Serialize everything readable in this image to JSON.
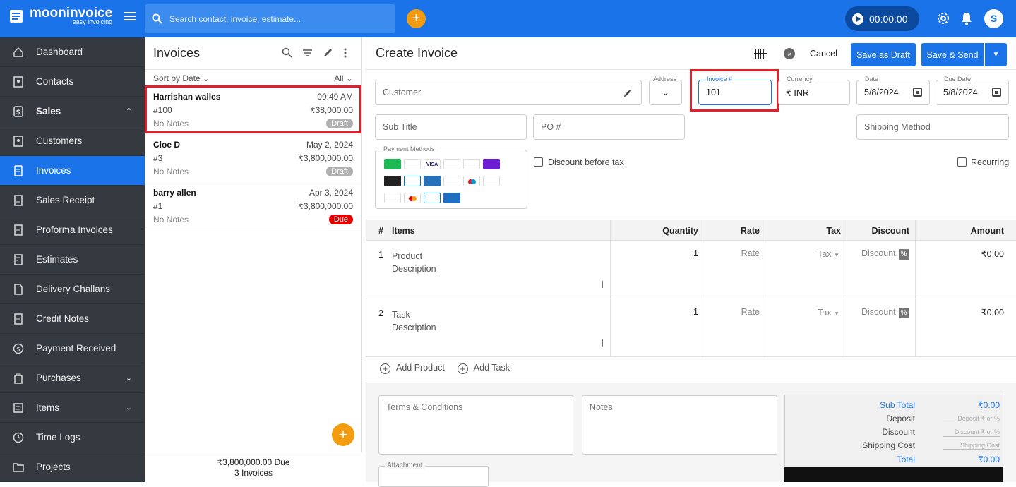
{
  "brand": {
    "name": "mooninvoice",
    "tagline": "easy invoicing"
  },
  "search": {
    "placeholder": "Search contact, invoice, estimate..."
  },
  "timer": {
    "value": "00:00:00"
  },
  "user": {
    "initial": "S"
  },
  "sidebar": {
    "items": [
      {
        "label": "Dashboard",
        "icon": "home-icon"
      },
      {
        "label": "Contacts",
        "icon": "contacts-icon"
      },
      {
        "label": "Sales",
        "icon": "dollar-icon",
        "expanded": true
      },
      {
        "label": "Customers",
        "icon": "customers-icon"
      },
      {
        "label": "Invoices",
        "icon": "invoice-icon",
        "active": true
      },
      {
        "label": "Sales Receipt",
        "icon": "receipt-icon"
      },
      {
        "label": "Proforma Invoices",
        "icon": "proforma-icon"
      },
      {
        "label": "Estimates",
        "icon": "estimate-icon"
      },
      {
        "label": "Delivery Challans",
        "icon": "delivery-icon"
      },
      {
        "label": "Credit Notes",
        "icon": "credit-note-icon"
      },
      {
        "label": "Payment Received",
        "icon": "payment-icon"
      },
      {
        "label": "Purchases",
        "icon": "purchase-icon"
      },
      {
        "label": "Items",
        "icon": "items-icon"
      },
      {
        "label": "Time Logs",
        "icon": "clock-icon"
      },
      {
        "label": "Projects",
        "icon": "folder-icon"
      }
    ]
  },
  "list": {
    "title": "Invoices",
    "sort_label": "Sort by Date",
    "filter_label": "All",
    "invoices": [
      {
        "name": "Harrishan walles",
        "date": "09:49 AM",
        "number": "#100",
        "amount": "₹38,000.00",
        "notes": "No Notes",
        "status": "Draft"
      },
      {
        "name": "Cloe D",
        "date": "May 2, 2024",
        "number": "#3",
        "amount": "₹3,800,000.00",
        "notes": "No Notes",
        "status": "Draft"
      },
      {
        "name": "barry allen",
        "date": "Apr 3, 2024",
        "number": "#1",
        "amount": "₹3,800,000.00",
        "notes": "No Notes",
        "status": "Due"
      }
    ],
    "footer_due": "₹3,800,000.00  Due",
    "footer_count": "3 Invoices"
  },
  "main": {
    "title": "Create Invoice",
    "cancel": "Cancel",
    "save_draft": "Save as Draft",
    "save_send": "Save & Send",
    "customer_placeholder": "Customer",
    "address_label": "Address",
    "invoice_label": "Invoice #",
    "invoice_value": "101",
    "currency_label": "Currency",
    "currency_value": "₹ INR",
    "date_label": "Date",
    "date_value": "5/8/2024",
    "due_label": "Due Date",
    "due_value": "5/8/2024",
    "subtitle_placeholder": "Sub Title",
    "po_placeholder": "PO #",
    "shipping_placeholder": "Shipping Method",
    "payment_methods_label": "Payment Methods",
    "discount_before_tax": "Discount before tax",
    "recurring": "Recurring"
  },
  "table": {
    "headers": {
      "num": "#",
      "items": "Items",
      "quantity": "Quantity",
      "rate": "Rate",
      "tax": "Tax",
      "discount": "Discount",
      "amount": "Amount"
    },
    "rows": [
      {
        "num": "1",
        "item": "Product",
        "desc": "Description",
        "qty": "1",
        "rate": "Rate",
        "tax": "Tax",
        "discount": "Discount",
        "pct": "%",
        "amount": "₹0.00"
      },
      {
        "num": "2",
        "item": "Task",
        "desc": "Description",
        "qty": "1",
        "rate": "Rate",
        "tax": "Tax",
        "discount": "Discount",
        "pct": "%",
        "amount": "₹0.00"
      }
    ],
    "add_product": "Add Product",
    "add_task": "Add Task"
  },
  "footer": {
    "terms_placeholder": "Terms & Conditions",
    "notes_placeholder": "Notes",
    "attachment_label": "Attachment",
    "totals": {
      "subtotal_label": "Sub Total",
      "subtotal_value": "₹0.00",
      "deposit_label": "Deposit",
      "deposit_placeholder": "Deposit ₹ or %",
      "discount_label": "Discount",
      "discount_placeholder": "Discount ₹ or %",
      "shipping_label": "Shipping Cost",
      "shipping_placeholder": "Shipping Cost",
      "total_label": "Total",
      "total_value": "₹0.00"
    }
  },
  "colors": {
    "primary": "#1a73e8",
    "sidebar": "#343a40",
    "accent": "#f39c12",
    "highlight": "#e0202a",
    "due": "#e60000"
  }
}
